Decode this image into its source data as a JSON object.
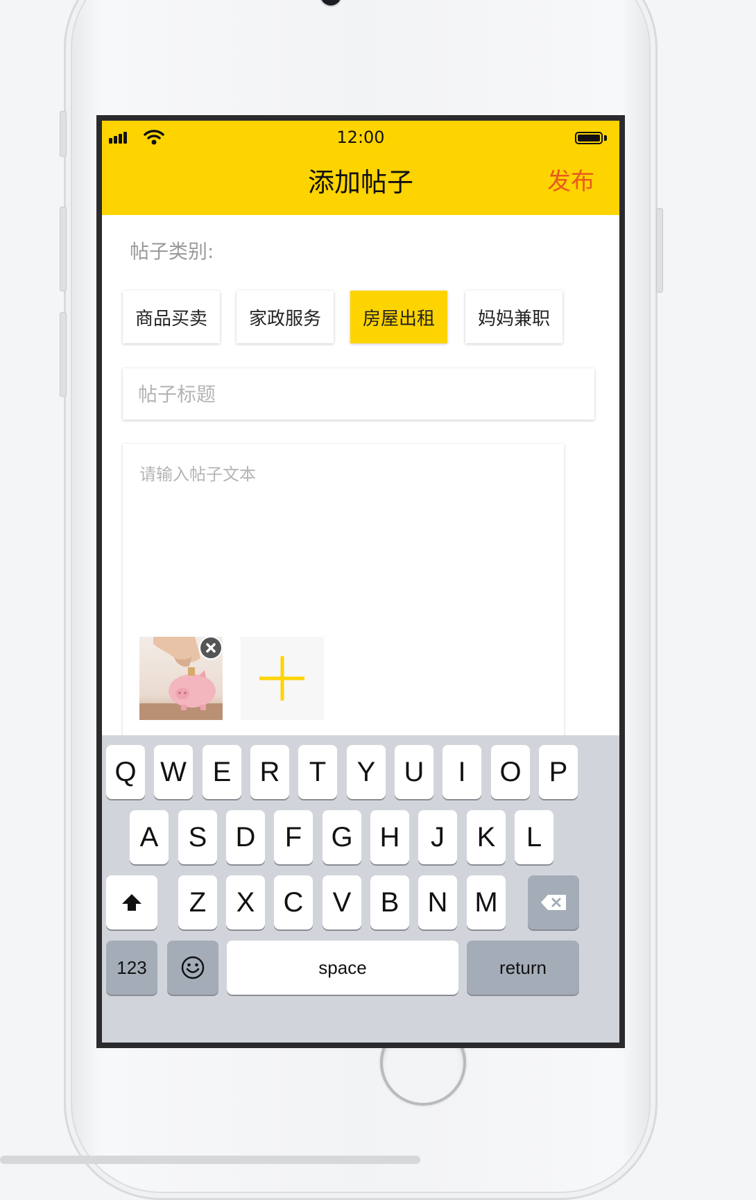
{
  "status_bar": {
    "time": "12:00"
  },
  "header": {
    "title": "添加帖子",
    "publish_label": "发布"
  },
  "form": {
    "category_label": "帖子类别:",
    "categories": [
      {
        "label": "商品买卖",
        "selected": false
      },
      {
        "label": "家政服务",
        "selected": false
      },
      {
        "label": "房屋出租",
        "selected": true
      },
      {
        "label": "妈妈兼职",
        "selected": false
      }
    ],
    "title_placeholder": "帖子标题",
    "content_placeholder": "请输入帖子文本",
    "images": [
      {
        "icon": "piggy-bank-photo"
      }
    ],
    "add_image_icon": "plus-icon"
  },
  "keyboard": {
    "row1": [
      "Q",
      "W",
      "E",
      "R",
      "T",
      "Y",
      "U",
      "I",
      "O",
      "P"
    ],
    "row2": [
      "A",
      "S",
      "D",
      "F",
      "G",
      "H",
      "J",
      "K",
      "L"
    ],
    "row3": [
      "Z",
      "X",
      "C",
      "V",
      "B",
      "N",
      "M"
    ],
    "numbers_label": "123",
    "space_label": "space",
    "return_label": "return"
  },
  "colors": {
    "accent": "#fed400",
    "publish": "#e85a1e"
  }
}
